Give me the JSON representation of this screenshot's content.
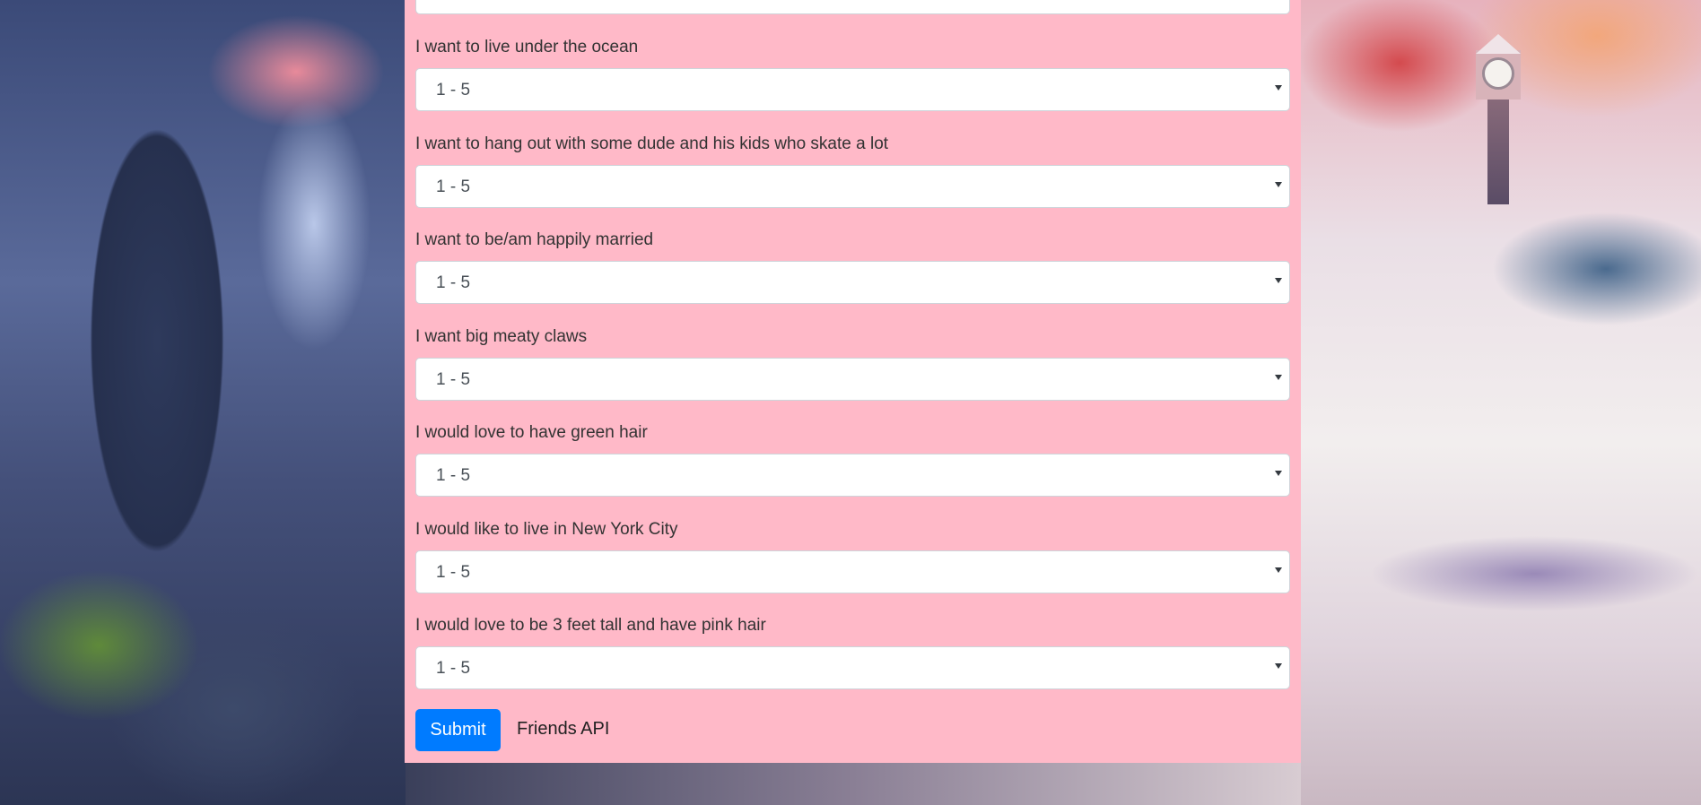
{
  "questions": [
    {
      "label": "I want to live under the ocean",
      "selected": "1 - 5"
    },
    {
      "label": "I want to hang out with some dude and his kids who skate a lot",
      "selected": "1 - 5"
    },
    {
      "label": "I want to be/am happily married",
      "selected": "1 - 5"
    },
    {
      "label": "I want big meaty claws",
      "selected": "1 - 5"
    },
    {
      "label": "I would love to have green hair",
      "selected": "1 - 5"
    },
    {
      "label": "I would like to live in New York City",
      "selected": "1 - 5"
    },
    {
      "label": "I would love to be 3 feet tall and have pink hair",
      "selected": "1 - 5"
    }
  ],
  "actions": {
    "submit_label": "Submit",
    "api_link_label": "Friends API"
  },
  "colors": {
    "panel_background": "#ffb9c8",
    "submit_button": "#007bff"
  },
  "icons": {
    "select_caret": "chevron-down-icon"
  }
}
